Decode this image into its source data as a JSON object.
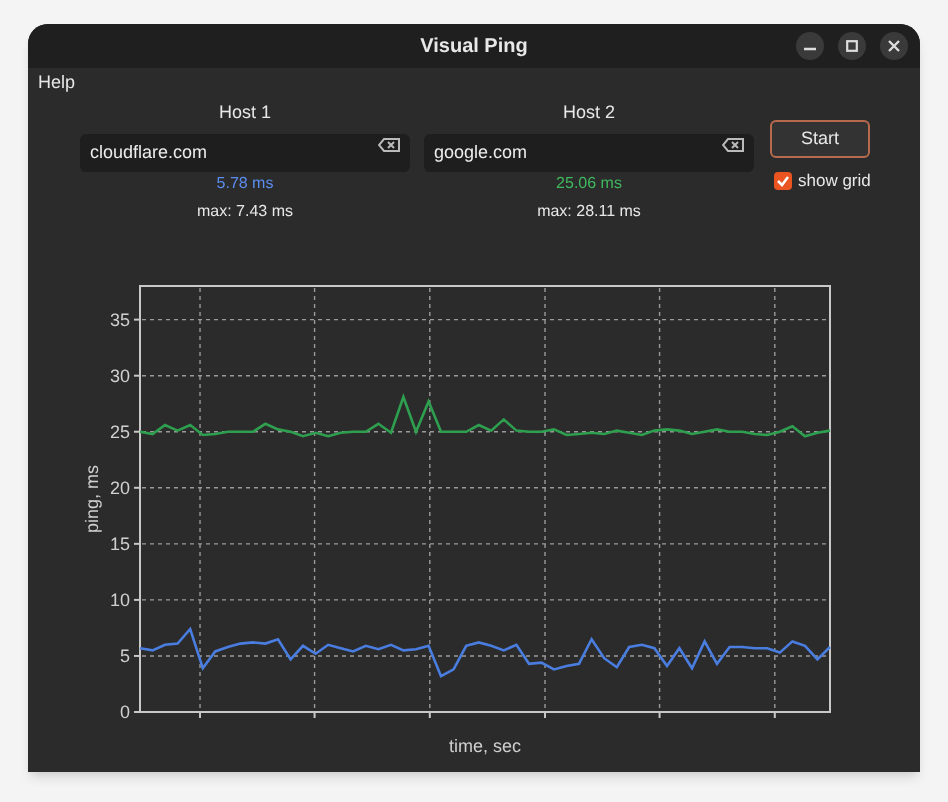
{
  "window": {
    "title": "Visual Ping"
  },
  "menu": [
    {
      "label": "Help"
    }
  ],
  "hosts": [
    {
      "label": "Host 1",
      "value": "cloudflare.com",
      "reading": "5.78 ms",
      "color": "#5b8def",
      "max": "max: 7.43 ms"
    },
    {
      "label": "Host 2",
      "value": "google.com",
      "reading": "25.06 ms",
      "color": "#3fb85f",
      "max": "max: 28.11 ms"
    }
  ],
  "start_button": {
    "label": "Start"
  },
  "show_grid": {
    "label": "show grid",
    "checked": true
  },
  "chart": {
    "chart_data": {
      "type": "line",
      "grid": true,
      "xlabel": "time, sec",
      "ylabel": "ping, ms",
      "ylim": [
        0,
        38
      ],
      "yticks": [
        0,
        5,
        10,
        15,
        20,
        25,
        30,
        35
      ],
      "series": [
        {
          "color": "#4a7de0",
          "values": [
            5.7,
            5.5,
            6,
            6.1,
            7.4,
            3.9,
            5.4,
            5.8,
            6.1,
            6.2,
            6.1,
            6.5,
            4.7,
            5.9,
            5.2,
            6,
            5.7,
            5.4,
            5.9,
            5.6,
            6,
            5.5,
            5.6,
            5.9,
            3.2,
            3.8,
            5.9,
            6.2,
            5.9,
            5.5,
            6,
            4.3,
            4.4,
            3.8,
            4.1,
            4.3,
            6.5,
            4.8,
            4,
            5.8,
            6,
            5.7,
            4.1,
            5.7,
            3.9,
            6.3,
            4.3,
            5.8,
            5.8,
            5.7,
            5.7,
            5.3,
            6.3,
            5.9,
            4.7,
            5.8
          ]
        },
        {
          "color": "#2e9e4f",
          "values": [
            25,
            24.8,
            25.6,
            25.1,
            25.6,
            24.7,
            24.8,
            25,
            25,
            25,
            25.7,
            25.2,
            25,
            24.6,
            24.9,
            24.6,
            24.9,
            25,
            25,
            25.7,
            24.9,
            28.1,
            25,
            27.7,
            25,
            25,
            25,
            25.6,
            25.1,
            26.1,
            25.1,
            25,
            25,
            25.2,
            24.7,
            24.8,
            24.9,
            24.8,
            25.1,
            24.9,
            24.7,
            25.1,
            25.2,
            25.1,
            24.8,
            25,
            25.2,
            25,
            25,
            24.8,
            24.7,
            25,
            25.5,
            24.6,
            24.9,
            25.1
          ]
        }
      ]
    }
  }
}
